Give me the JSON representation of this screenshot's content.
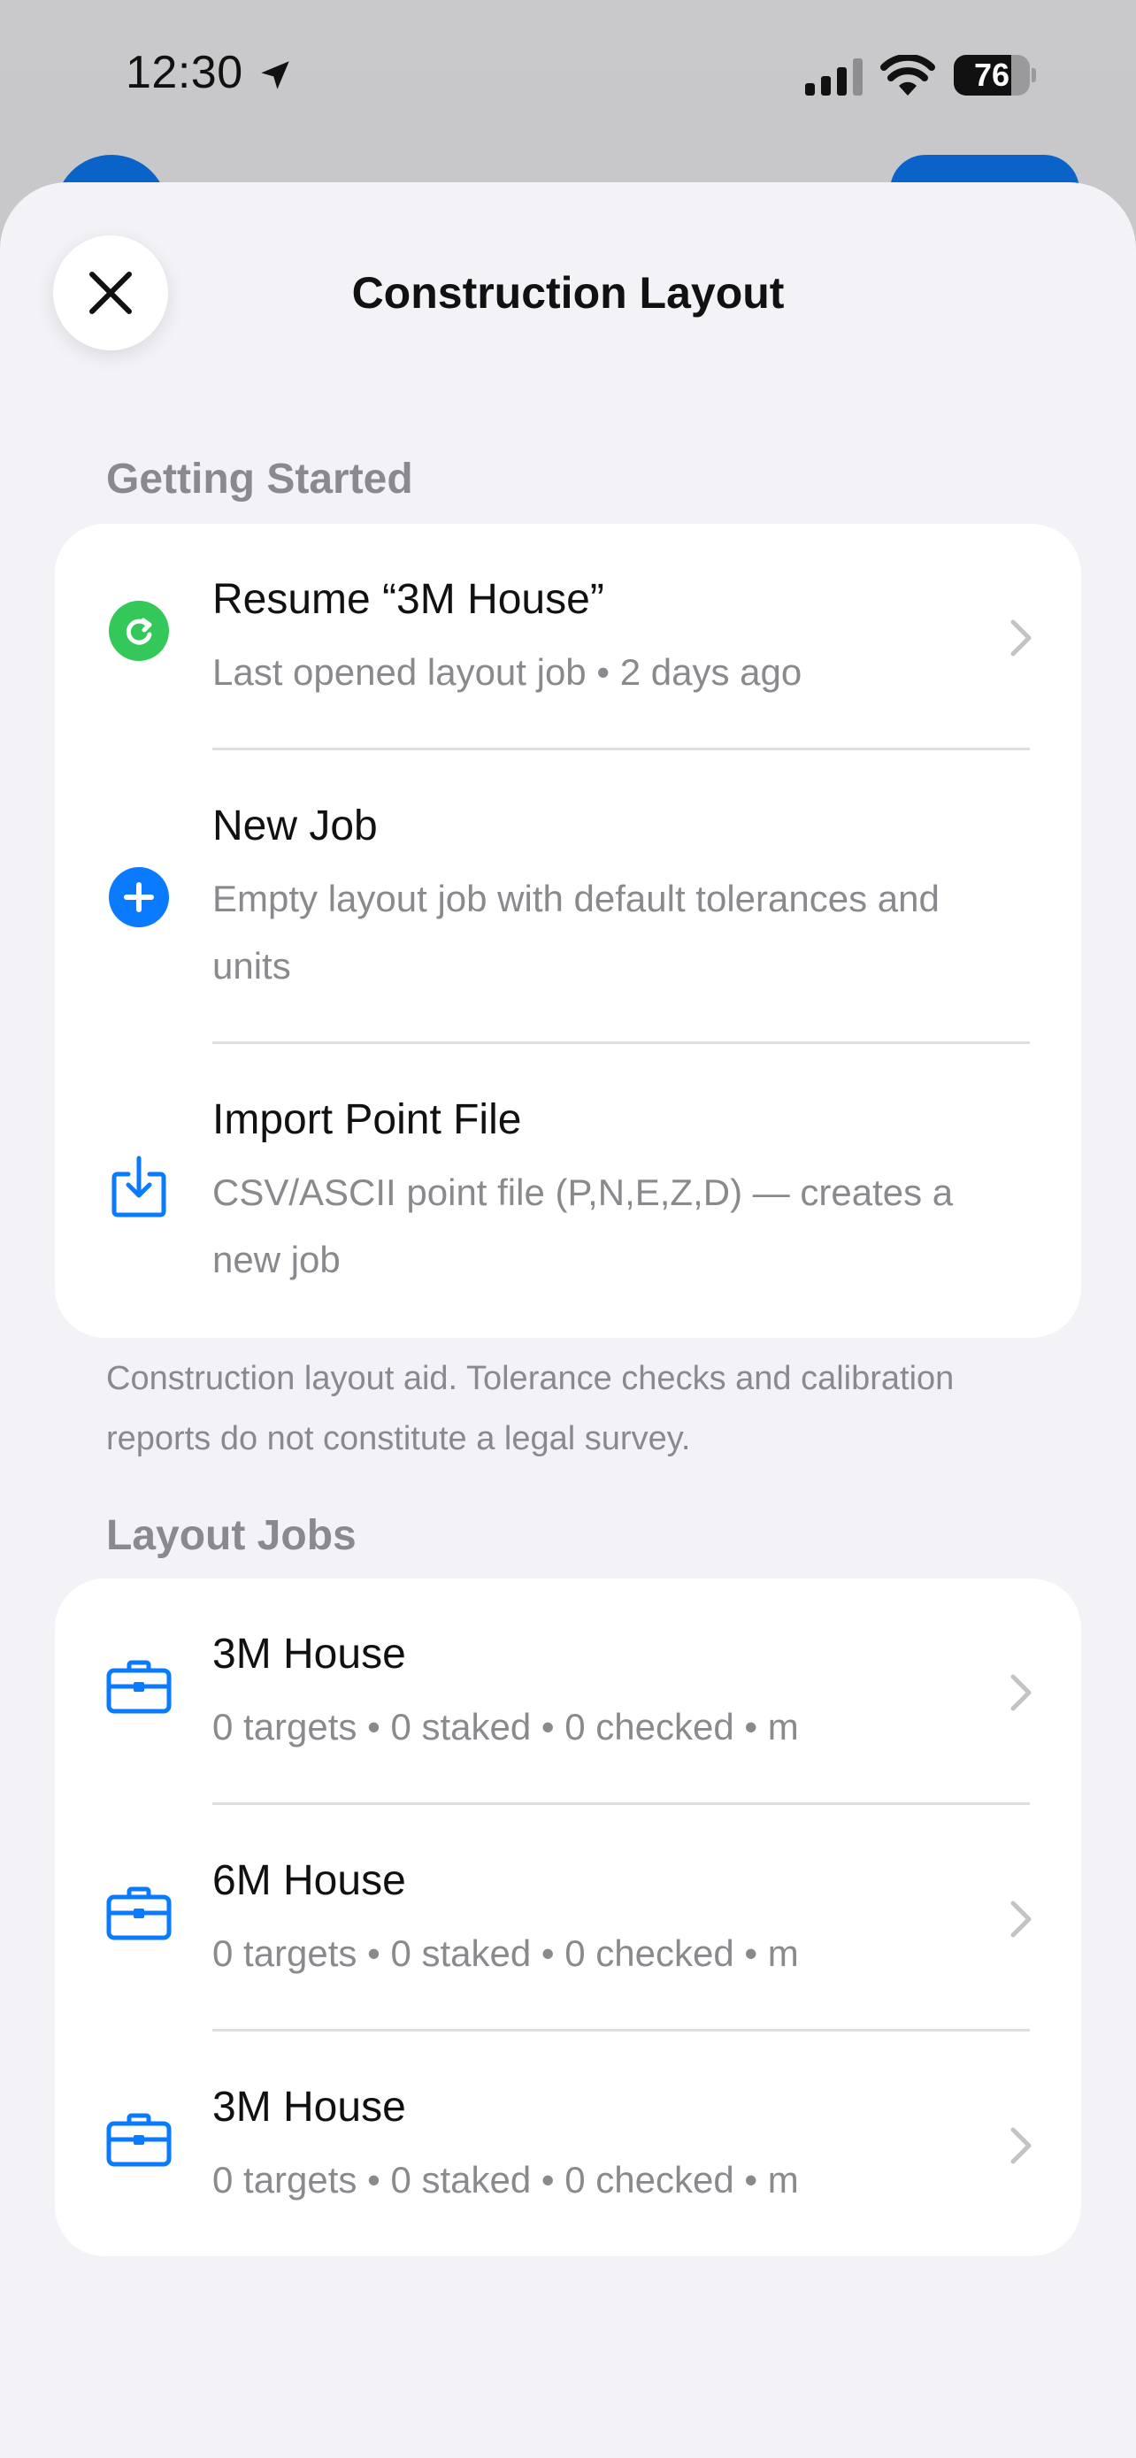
{
  "status_bar": {
    "time": "12:30",
    "battery_level": "76",
    "battery_fraction": 0.76
  },
  "sheet": {
    "title": "Construction Layout",
    "close_icon": "xmark-icon"
  },
  "getting_started": {
    "header": "Getting Started",
    "items": [
      {
        "title": "Resume “3M House”",
        "subtitle": "Last opened layout job • 2 days ago",
        "icon": "arrow-clockwise-circle-icon",
        "icon_color": "#34c759"
      },
      {
        "title": "New Job",
        "subtitle": "Empty layout job with default tolerances and units",
        "icon": "plus-circle-icon",
        "icon_color": "#0a7bff"
      },
      {
        "title": "Import Point File",
        "subtitle": "CSV/ASCII point file (P,N,E,Z,D) — creates a new job",
        "icon": "tray-download-icon",
        "icon_color": "#0a7bff"
      }
    ]
  },
  "footnote": "Construction layout aid. Tolerance checks and calibration reports do not constitute a legal survey.",
  "layout_jobs": {
    "header": "Layout Jobs",
    "items": [
      {
        "title": "3M House",
        "subtitle": "0 targets • 0 staked • 0 checked • m",
        "icon": "briefcase-icon"
      },
      {
        "title": "6M House",
        "subtitle": "0 targets • 0 staked • 0 checked • m",
        "icon": "briefcase-icon"
      },
      {
        "title": "3M House",
        "subtitle": "0 targets • 0 staked • 0 checked • m",
        "icon": "briefcase-icon"
      }
    ]
  },
  "colors": {
    "accent": "#0a7bff",
    "resume_green": "#34c759",
    "sheet_background": "#f2f2f7",
    "secondary_text": "#8a8a8e"
  }
}
